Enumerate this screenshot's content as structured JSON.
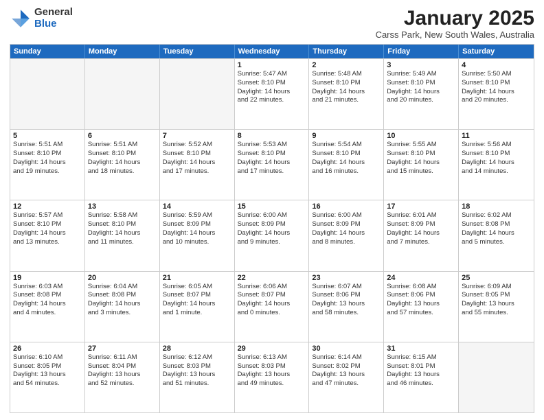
{
  "logo": {
    "general": "General",
    "blue": "Blue"
  },
  "title": "January 2025",
  "subtitle": "Carss Park, New South Wales, Australia",
  "weekdays": [
    "Sunday",
    "Monday",
    "Tuesday",
    "Wednesday",
    "Thursday",
    "Friday",
    "Saturday"
  ],
  "weeks": [
    [
      {
        "day": "",
        "info": ""
      },
      {
        "day": "",
        "info": ""
      },
      {
        "day": "",
        "info": ""
      },
      {
        "day": "1",
        "info": "Sunrise: 5:47 AM\nSunset: 8:10 PM\nDaylight: 14 hours\nand 22 minutes."
      },
      {
        "day": "2",
        "info": "Sunrise: 5:48 AM\nSunset: 8:10 PM\nDaylight: 14 hours\nand 21 minutes."
      },
      {
        "day": "3",
        "info": "Sunrise: 5:49 AM\nSunset: 8:10 PM\nDaylight: 14 hours\nand 20 minutes."
      },
      {
        "day": "4",
        "info": "Sunrise: 5:50 AM\nSunset: 8:10 PM\nDaylight: 14 hours\nand 20 minutes."
      }
    ],
    [
      {
        "day": "5",
        "info": "Sunrise: 5:51 AM\nSunset: 8:10 PM\nDaylight: 14 hours\nand 19 minutes."
      },
      {
        "day": "6",
        "info": "Sunrise: 5:51 AM\nSunset: 8:10 PM\nDaylight: 14 hours\nand 18 minutes."
      },
      {
        "day": "7",
        "info": "Sunrise: 5:52 AM\nSunset: 8:10 PM\nDaylight: 14 hours\nand 17 minutes."
      },
      {
        "day": "8",
        "info": "Sunrise: 5:53 AM\nSunset: 8:10 PM\nDaylight: 14 hours\nand 17 minutes."
      },
      {
        "day": "9",
        "info": "Sunrise: 5:54 AM\nSunset: 8:10 PM\nDaylight: 14 hours\nand 16 minutes."
      },
      {
        "day": "10",
        "info": "Sunrise: 5:55 AM\nSunset: 8:10 PM\nDaylight: 14 hours\nand 15 minutes."
      },
      {
        "day": "11",
        "info": "Sunrise: 5:56 AM\nSunset: 8:10 PM\nDaylight: 14 hours\nand 14 minutes."
      }
    ],
    [
      {
        "day": "12",
        "info": "Sunrise: 5:57 AM\nSunset: 8:10 PM\nDaylight: 14 hours\nand 13 minutes."
      },
      {
        "day": "13",
        "info": "Sunrise: 5:58 AM\nSunset: 8:10 PM\nDaylight: 14 hours\nand 11 minutes."
      },
      {
        "day": "14",
        "info": "Sunrise: 5:59 AM\nSunset: 8:09 PM\nDaylight: 14 hours\nand 10 minutes."
      },
      {
        "day": "15",
        "info": "Sunrise: 6:00 AM\nSunset: 8:09 PM\nDaylight: 14 hours\nand 9 minutes."
      },
      {
        "day": "16",
        "info": "Sunrise: 6:00 AM\nSunset: 8:09 PM\nDaylight: 14 hours\nand 8 minutes."
      },
      {
        "day": "17",
        "info": "Sunrise: 6:01 AM\nSunset: 8:09 PM\nDaylight: 14 hours\nand 7 minutes."
      },
      {
        "day": "18",
        "info": "Sunrise: 6:02 AM\nSunset: 8:08 PM\nDaylight: 14 hours\nand 5 minutes."
      }
    ],
    [
      {
        "day": "19",
        "info": "Sunrise: 6:03 AM\nSunset: 8:08 PM\nDaylight: 14 hours\nand 4 minutes."
      },
      {
        "day": "20",
        "info": "Sunrise: 6:04 AM\nSunset: 8:08 PM\nDaylight: 14 hours\nand 3 minutes."
      },
      {
        "day": "21",
        "info": "Sunrise: 6:05 AM\nSunset: 8:07 PM\nDaylight: 14 hours\nand 1 minute."
      },
      {
        "day": "22",
        "info": "Sunrise: 6:06 AM\nSunset: 8:07 PM\nDaylight: 14 hours\nand 0 minutes."
      },
      {
        "day": "23",
        "info": "Sunrise: 6:07 AM\nSunset: 8:06 PM\nDaylight: 13 hours\nand 58 minutes."
      },
      {
        "day": "24",
        "info": "Sunrise: 6:08 AM\nSunset: 8:06 PM\nDaylight: 13 hours\nand 57 minutes."
      },
      {
        "day": "25",
        "info": "Sunrise: 6:09 AM\nSunset: 8:05 PM\nDaylight: 13 hours\nand 55 minutes."
      }
    ],
    [
      {
        "day": "26",
        "info": "Sunrise: 6:10 AM\nSunset: 8:05 PM\nDaylight: 13 hours\nand 54 minutes."
      },
      {
        "day": "27",
        "info": "Sunrise: 6:11 AM\nSunset: 8:04 PM\nDaylight: 13 hours\nand 52 minutes."
      },
      {
        "day": "28",
        "info": "Sunrise: 6:12 AM\nSunset: 8:03 PM\nDaylight: 13 hours\nand 51 minutes."
      },
      {
        "day": "29",
        "info": "Sunrise: 6:13 AM\nSunset: 8:03 PM\nDaylight: 13 hours\nand 49 minutes."
      },
      {
        "day": "30",
        "info": "Sunrise: 6:14 AM\nSunset: 8:02 PM\nDaylight: 13 hours\nand 47 minutes."
      },
      {
        "day": "31",
        "info": "Sunrise: 6:15 AM\nSunset: 8:01 PM\nDaylight: 13 hours\nand 46 minutes."
      },
      {
        "day": "",
        "info": ""
      }
    ]
  ]
}
